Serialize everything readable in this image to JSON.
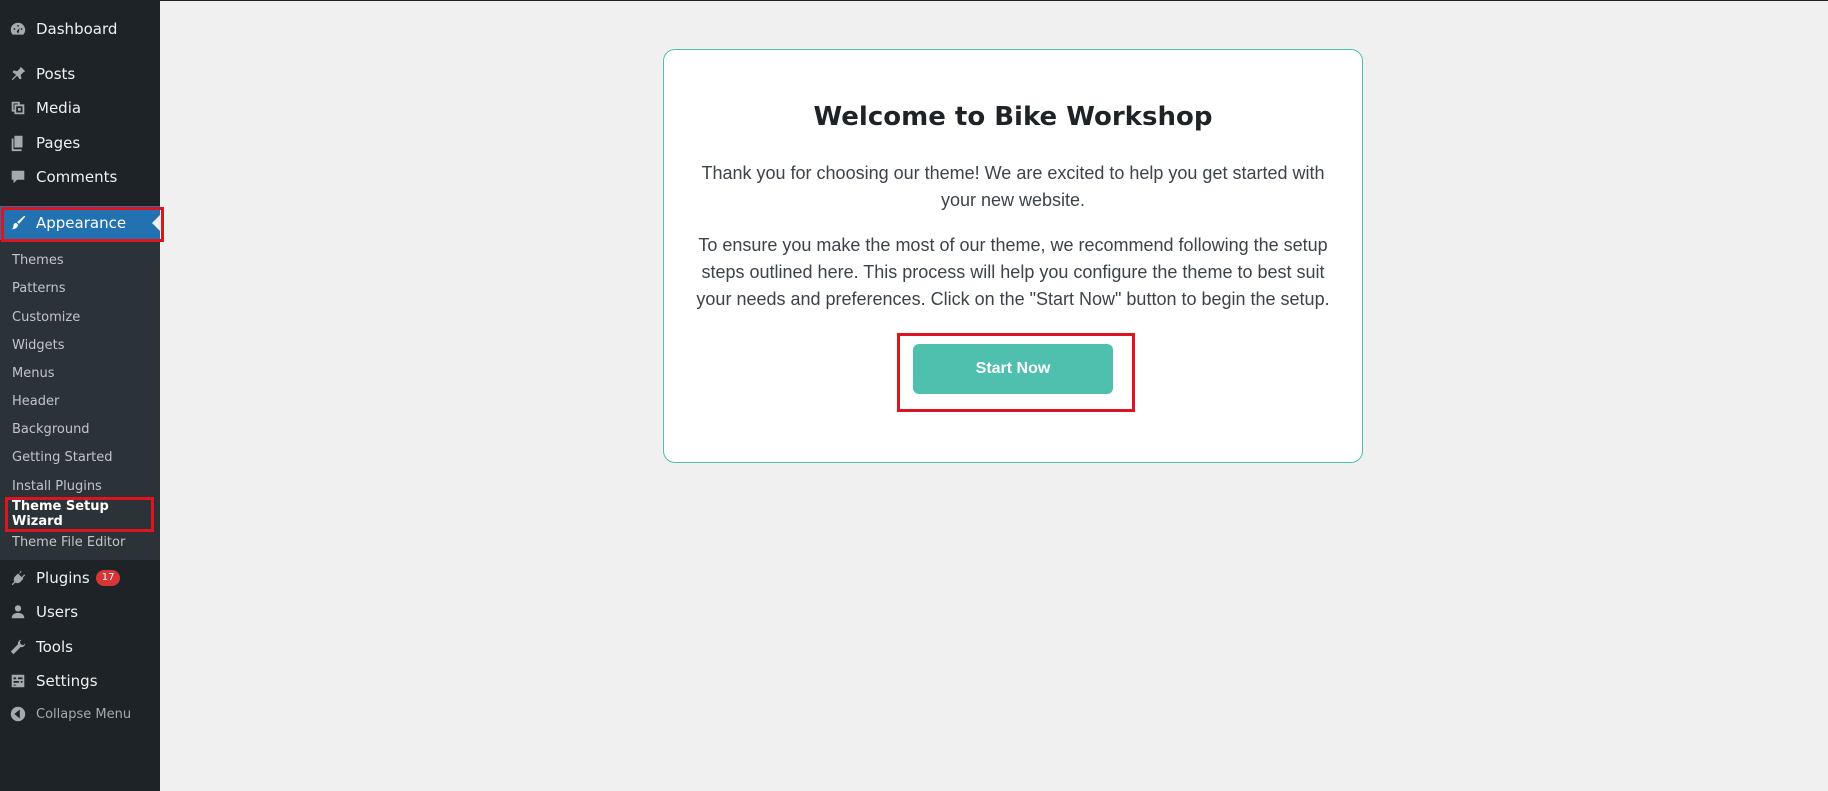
{
  "sidebar": {
    "items": [
      {
        "label": "Dashboard",
        "icon": "dashboard-icon"
      },
      {
        "label": "Posts",
        "icon": "pin-icon"
      },
      {
        "label": "Media",
        "icon": "media-icon"
      },
      {
        "label": "Pages",
        "icon": "pages-icon"
      },
      {
        "label": "Comments",
        "icon": "comment-icon"
      },
      {
        "label": "Appearance",
        "icon": "paintbrush-icon"
      },
      {
        "label": "Plugins",
        "icon": "plug-icon",
        "badge": "17"
      },
      {
        "label": "Users",
        "icon": "user-icon"
      },
      {
        "label": "Tools",
        "icon": "wrench-icon"
      },
      {
        "label": "Settings",
        "icon": "settings-icon"
      },
      {
        "label": "Collapse Menu",
        "icon": "collapse-icon"
      }
    ],
    "submenu": [
      "Themes",
      "Patterns",
      "Customize",
      "Widgets",
      "Menus",
      "Header",
      "Background",
      "Getting Started",
      "Install Plugins",
      "Theme Setup Wizard",
      "Theme File Editor"
    ]
  },
  "card": {
    "title": "Welcome to Bike Workshop",
    "paragraph1": "Thank you for choosing our theme! We are excited to help you get started with your new website.",
    "paragraph2": "To ensure you make the most of our theme, we recommend following the setup steps outlined here. This process will help you configure the theme to best suit your needs and preferences. Click on the \"Start Now\" button to begin the setup.",
    "button_label": "Start Now"
  },
  "colors": {
    "sidebar_bg": "#1d2327",
    "submenu_bg": "#2c3338",
    "active_bg": "#2271b1",
    "accent": "#4fbfae",
    "highlight": "#e0141e",
    "badge": "#d63638"
  }
}
